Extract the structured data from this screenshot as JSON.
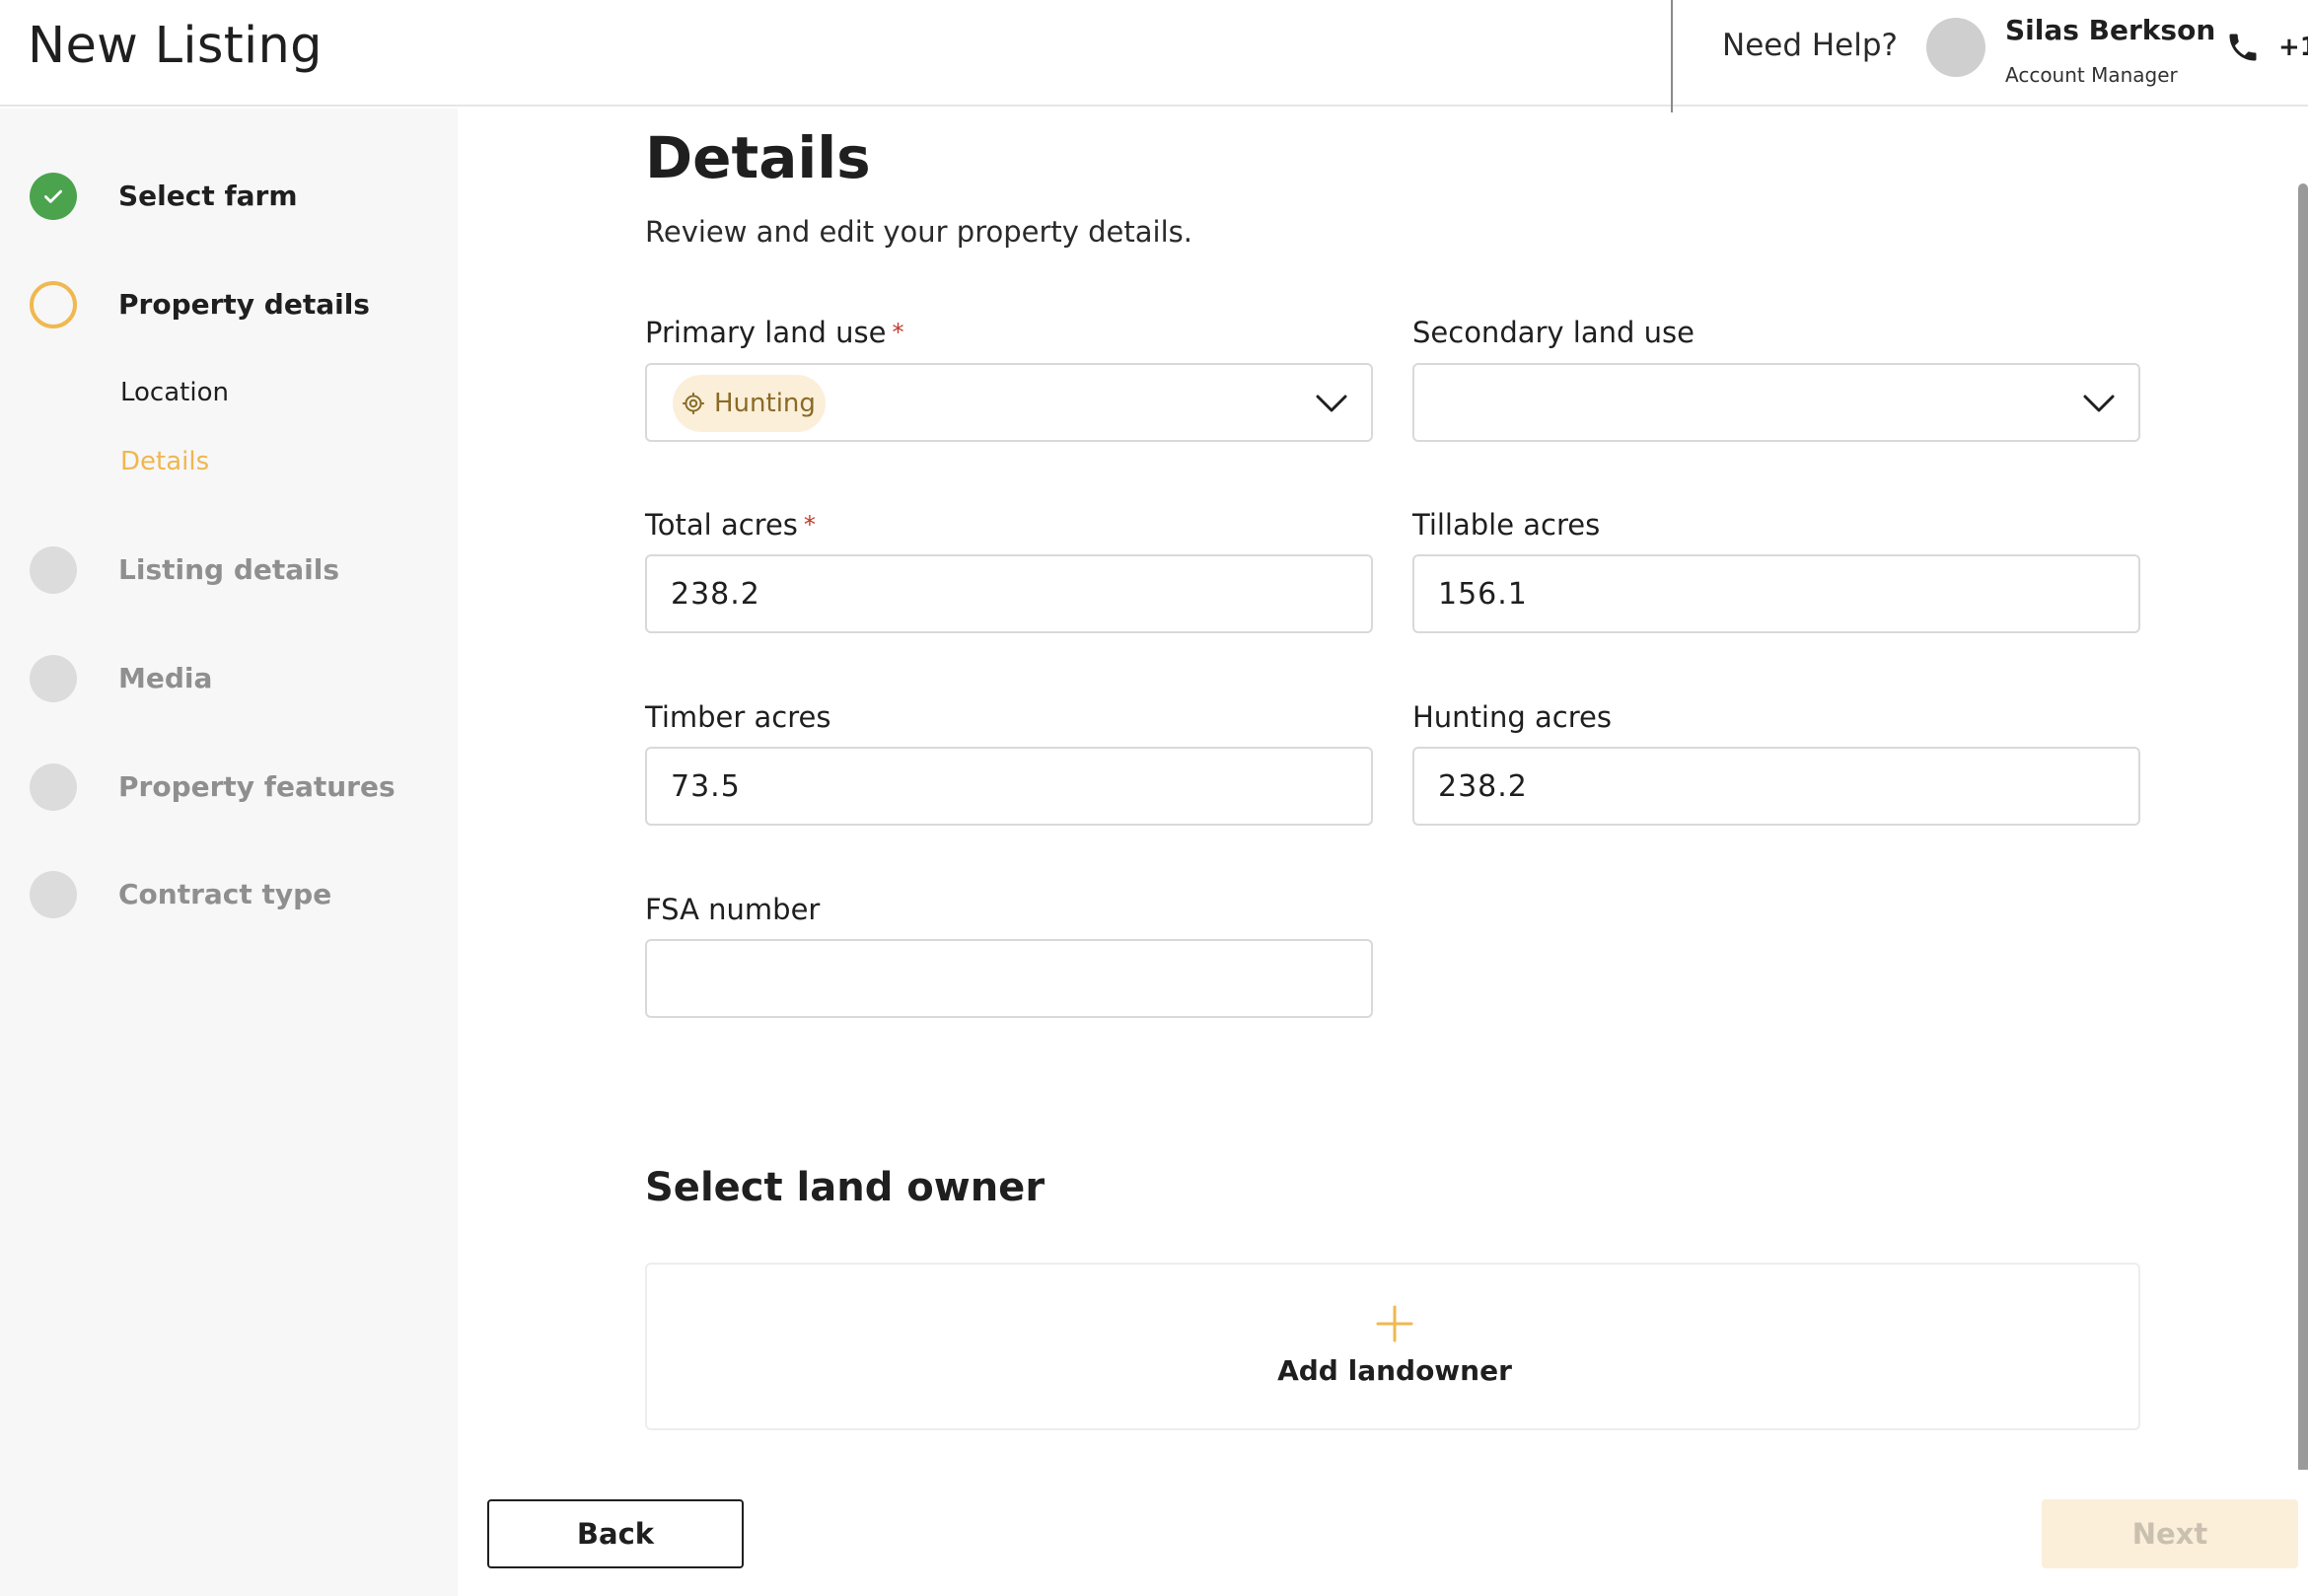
{
  "header": {
    "title": "New Listing",
    "help_text": "Need Help?",
    "manager_name": "Silas Berkson",
    "manager_role": "Account Manager",
    "phone_text": "+1"
  },
  "sidebar": {
    "steps": [
      {
        "label": "Select farm",
        "state": "done"
      },
      {
        "label": "Property details",
        "state": "current"
      },
      {
        "label": "Listing details",
        "state": "todo"
      },
      {
        "label": "Media",
        "state": "todo"
      },
      {
        "label": "Property features",
        "state": "todo"
      },
      {
        "label": "Contract type",
        "state": "todo"
      }
    ],
    "substeps": [
      {
        "label": "Location",
        "state": "plain"
      },
      {
        "label": "Details",
        "state": "active"
      }
    ]
  },
  "main": {
    "title": "Details",
    "subtitle": "Review and edit your property details.",
    "required_mark": "*",
    "fields": {
      "primary_land_use": {
        "label": "Primary land use",
        "value": "Hunting",
        "required": true
      },
      "secondary_land_use": {
        "label": "Secondary land use",
        "value": ""
      },
      "total_acres": {
        "label": "Total acres",
        "value": "238.2",
        "required": true
      },
      "tillable_acres": {
        "label": "Tillable acres",
        "value": "156.1"
      },
      "timber_acres": {
        "label": "Timber acres",
        "value": "73.5"
      },
      "hunting_acres": {
        "label": "Hunting acres",
        "value": "238.2"
      },
      "fsa_number": {
        "label": "FSA number",
        "value": ""
      }
    },
    "land_owner": {
      "heading": "Select land owner",
      "add_label": "Add landowner"
    }
  },
  "footer": {
    "back_label": "Back",
    "next_label": "Next"
  },
  "colors": {
    "accent": "#f0b850",
    "done": "#4ba34e",
    "todo": "#dcdcdc",
    "chip_bg": "#fbefd9"
  }
}
